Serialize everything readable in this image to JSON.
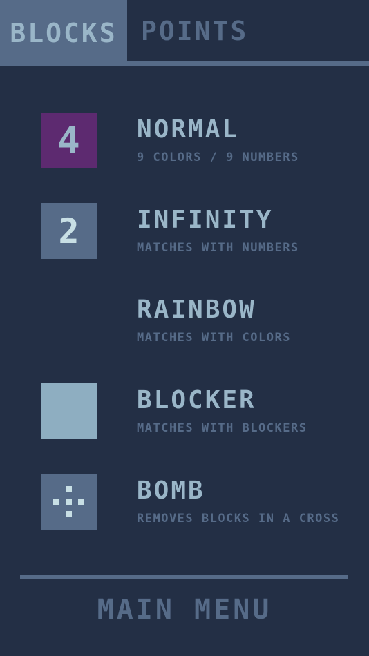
{
  "tabs": {
    "blocks_label": "BLOCKS",
    "points_label": "POINTS",
    "active": "BLOCKS"
  },
  "blocks": [
    {
      "title": "NORMAL",
      "description": "9 COLORS / 9 NUMBERS",
      "icon": "number-block-icon",
      "icon_text": "4",
      "color": "#5d2a70"
    },
    {
      "title": "INFINITY",
      "description": "MATCHES WITH NUMBERS",
      "icon": "infinity-block-icon",
      "icon_text": "2",
      "color": "#566b88"
    },
    {
      "title": "RAINBOW",
      "description": "MATCHES WITH COLORS",
      "icon": "rainbow-block-icon",
      "colors": [
        "#e86248",
        "#c4243e",
        "#7b1250",
        "#a06838",
        "#2d5d6d",
        "#6a3a8c",
        "#f0b040",
        "#168a60",
        "#3f55c0"
      ]
    },
    {
      "title": "BLOCKER",
      "description": "MATCHES WITH BLOCKERS",
      "icon": "blocker-block-icon",
      "color": "#8eaec1"
    },
    {
      "title": "BOMB",
      "description": "REMOVES BLOCKS IN A CROSS",
      "icon": "bomb-block-icon",
      "color": "#566b88"
    }
  ],
  "footer": {
    "main_menu_label": "MAIN MENU"
  },
  "colors": {
    "background": "#232f45",
    "panel": "#566b88",
    "text_light": "#9ab6c8"
  }
}
